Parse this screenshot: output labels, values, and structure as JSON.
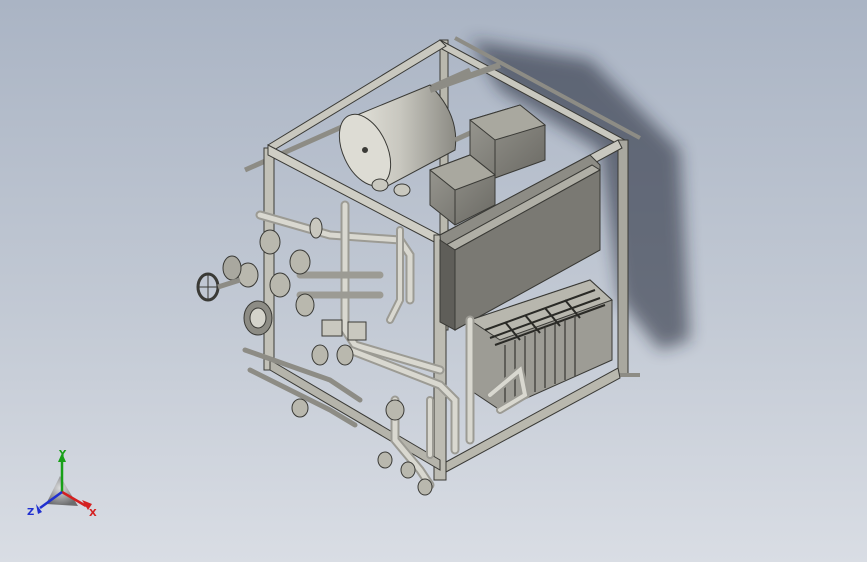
{
  "triad": {
    "x_label": "X",
    "y_label": "Y",
    "z_label": "Z",
    "x_color": "#d42020",
    "y_color": "#18a018",
    "z_color": "#2030d0"
  },
  "colors": {
    "frame": "#b9b8ae",
    "frame_dark": "#6e6d66",
    "panel": "#8d8c85",
    "panel_dark": "#5f5e59",
    "pipe": "#c9c8bf",
    "shadow": "#1c2230"
  }
}
